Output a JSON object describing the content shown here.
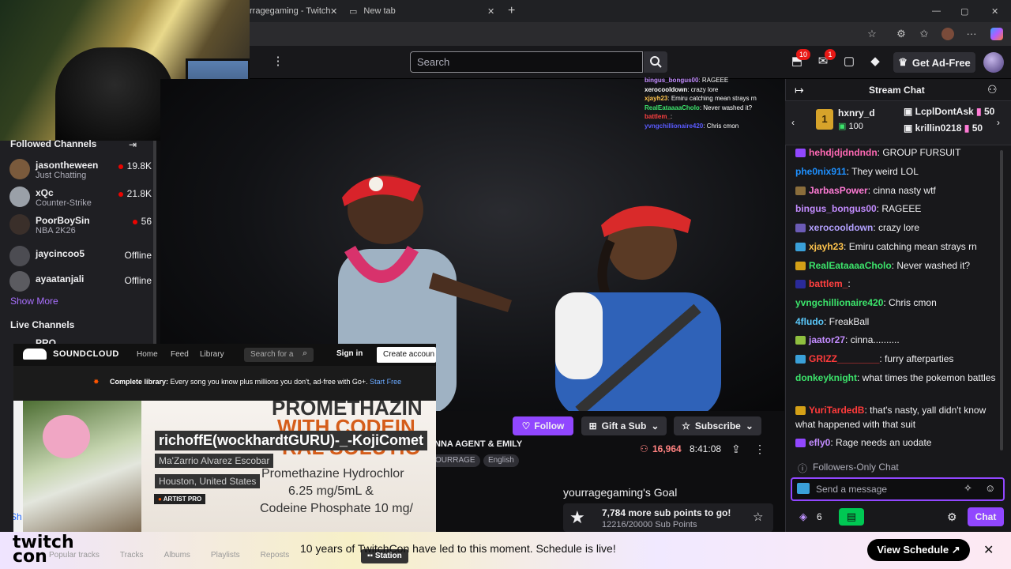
{
  "browser": {
    "tab_active": "rragegaming - Twitch",
    "tab_new": "New tab"
  },
  "topnav": {
    "search_placeholder": "Search",
    "inbox_count": "10",
    "notif_count": "1",
    "adfree_label": "Get Ad-Free"
  },
  "sidebar": {
    "followed_heading": "Followed Channels",
    "channels": [
      {
        "name": "jasontheween",
        "sub": "Just Chatting",
        "count": "19.8K",
        "avatar": "#7a5a3c"
      },
      {
        "name": "xQc",
        "sub": "Counter-Strike",
        "count": "21.8K",
        "avatar": "#9aa0a8"
      },
      {
        "name": "PoorBoySin",
        "sub": "NBA 2K26",
        "count": "56",
        "avatar": "#3a2f2a"
      },
      {
        "name": "jaycincoo5",
        "status": "Offline",
        "avatar": "#4c4c52"
      },
      {
        "name": "ayaatanjali",
        "status": "Offline",
        "avatar": "#5b5b60"
      }
    ],
    "show_more": "Show More",
    "live_heading": "Live Channels",
    "live_partial": "PRO"
  },
  "video_chat_overlay": [
    {
      "user": "bingus_bongus00",
      "msg": "RAGEEE",
      "color": "#c38cff"
    },
    {
      "user": "xerocooldown",
      "msg": "crazy lore",
      "color": "#ffffff"
    },
    {
      "user": "xjayh23",
      "msg": "Emiru catching mean strays rn",
      "color": "#ffc44d"
    },
    {
      "user": "RealEataaaaCholo",
      "msg": "Never washed it?",
      "color": "#3ce46b"
    },
    {
      "user": "battlem_",
      "msg": "",
      "color": "#ff4040"
    },
    {
      "user": "yvngchillionaire420",
      "msg": "Chris cmon",
      "color": "#5a5aff"
    }
  ],
  "stream": {
    "follow_label": "Follow",
    "giftsub_label": "Gift a Sub",
    "subscribe_label": "Subscribe",
    "viewers": "16,964",
    "uptime": "8:41:08",
    "title": "NNA AGENT & EMILY",
    "tags": [
      "OURRAGE",
      "English"
    ],
    "goal_title": "yourragegaming's Goal",
    "goal_line": "7,784 more sub points to go!",
    "goal_progress": "12216/20000 Sub Points",
    "goal_fraction": 0.6108
  },
  "soundcloud": {
    "logo": "SOUNDCLOUD",
    "nav": [
      "Home",
      "Feed",
      "Library"
    ],
    "search_placeholder": "Search for a",
    "sign_in": "Sign in",
    "create_account": "Create accoun",
    "banner_bold": "Complete library:",
    "banner_text": "Every song you know plus millions you don't, ad-free with Go+.",
    "banner_link": "Start Free",
    "track_title": "richoffE(wockhardtGURU)-_-KojiComet",
    "artist": "Ma'Zarrio Alvarez Escobar",
    "location": "Houston, United States",
    "artist_pro": "ARTIST PRO",
    "bg_text_1": "PROMETHAZIN",
    "bg_text_2": "WITH CODEIN",
    "bg_text_3": "RAL SOLUTIO",
    "bg_text_4": "Promethazine Hydrochlor",
    "bg_text_5": "6.25 mg/5mL &",
    "bg_text_6": "Codeine Phosphate 10 mg/",
    "bottom_tabs": [
      "Popular tracks",
      "Tracks",
      "Albums",
      "Playlists",
      "Reposts"
    ],
    "station": "Station",
    "partial_left": "Sh"
  },
  "banner": {
    "logo_line1": "twitch",
    "logo_line2": "con",
    "text": "10 years of TwitchCon have led to this moment. Schedule is live!",
    "button": "View Schedule ↗"
  },
  "chat": {
    "header": "Stream Chat",
    "gifters": [
      {
        "name": "hxnry_d",
        "amount": "100"
      },
      {
        "name": "LcplDontAsk",
        "amount": "50"
      },
      {
        "name": "krillin0218",
        "amount": "50"
      }
    ],
    "messages": [
      {
        "user": "hehdjdjdndndn",
        "msg": ": GROUP FURSUIT",
        "color": "#ff69b4",
        "badge": "#9147ff"
      },
      {
        "user": "phe0nix911",
        "msg": ": They weird LOL",
        "color": "#1e90ff",
        "badge": ""
      },
      {
        "user": "JarbasPower",
        "msg": ": cinna nasty wtf",
        "color": "#ff7bd5",
        "badge": "#8a6d3b"
      },
      {
        "user": "bingus_bongus00",
        "msg": ": RAGEEE",
        "color": "#c38cff",
        "badge": ""
      },
      {
        "user": "xerocooldown",
        "msg": ": crazy lore",
        "color": "#b3a1ff",
        "badge": "#6b5bb5"
      },
      {
        "user": "xjayh23",
        "msg": ": Emiru catching mean strays rn",
        "color": "#ffc44d",
        "badge": "#3aa0d8"
      },
      {
        "user": "RealEataaaaCholo",
        "msg": ": Never washed it?",
        "color": "#3ce46b",
        "badge": "#d4a017"
      },
      {
        "user": "battlem_",
        "msg": ":",
        "color": "#ff4040",
        "badge": "#2a2a9a"
      },
      {
        "user": "yvngchillionaire420",
        "msg": ": Chris cmon",
        "color": "#3ce46b",
        "badge": ""
      },
      {
        "user": "4fludo",
        "msg": ": FreakBall",
        "color": "#5ac8fa",
        "badge": ""
      },
      {
        "user": "jaator27",
        "msg": ": cinna..........",
        "color": "#c38cff",
        "badge": "#8fbf3f"
      },
      {
        "user": "GRIZZ________",
        "msg": ": furry afterparties",
        "color": "#ff3b3b",
        "badge": "#3aa0d8"
      },
      {
        "user": "donkeyknight",
        "msg": ": what times the pokemon battles",
        "color": "#3ce46b",
        "badge": ""
      },
      {
        "user": "YuriTardedB",
        "msg": ": that's nasty, yall didn't know what happened with that suit",
        "color": "#ff3b3b",
        "badge": "#d4a017"
      },
      {
        "user": "efly0",
        "msg": ": Rage needs an uodate",
        "color": "#c38cff",
        "badge": "#9147ff"
      }
    ],
    "followers_only": "Followers-Only Chat",
    "input_placeholder": "Send a message",
    "points": "6",
    "chat_button": "Chat"
  }
}
